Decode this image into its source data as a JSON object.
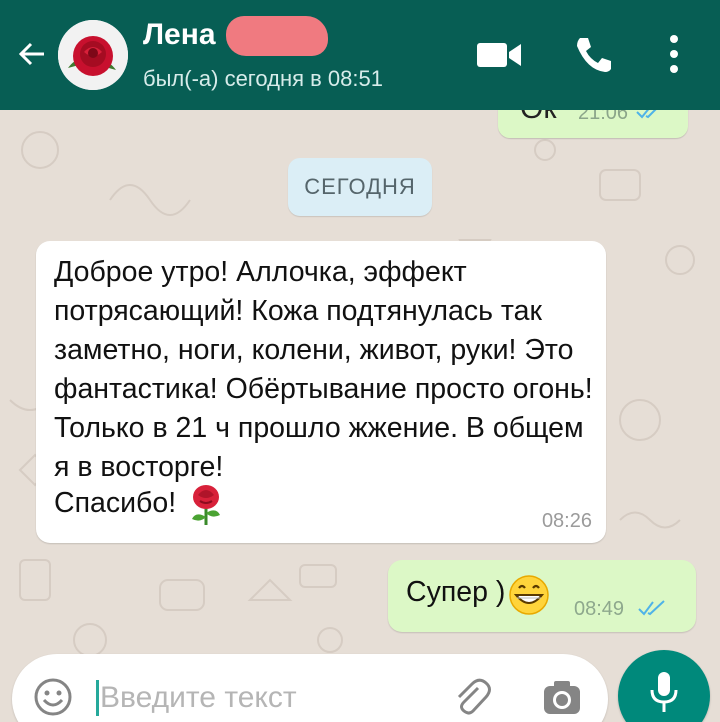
{
  "header": {
    "contact_name": "Лена",
    "status": "был(-а) сегодня в 08:51",
    "icons": [
      "back-arrow-icon",
      "video-call-icon",
      "phone-call-icon",
      "more-vert-icon"
    ],
    "color": "#075e54"
  },
  "chat": {
    "previous_message": {
      "text": "Ок",
      "time": "21:06"
    },
    "date_divider": "СЕГОДНЯ",
    "incoming": {
      "text": "Доброе утро! Аллочка, эффект потрясающий! Кожа подтянулась так заметно, ноги, колени, живот, руки! Это фантастика! Обёртывание просто огонь! Только в 21 ч прошло жжение. В общем я в восторге!",
      "thanks": "Спасибо!",
      "emoji": "rose-emoji",
      "time": "08:26"
    },
    "outgoing": {
      "text": "Супер )",
      "emoji": "grinning-emoji",
      "time": "08:49"
    }
  },
  "composer": {
    "placeholder": "Введите текст",
    "value": "",
    "icons": [
      "emoji-icon",
      "attach-icon",
      "camera-icon",
      "mic-icon"
    ],
    "mic_color": "#00897b"
  }
}
